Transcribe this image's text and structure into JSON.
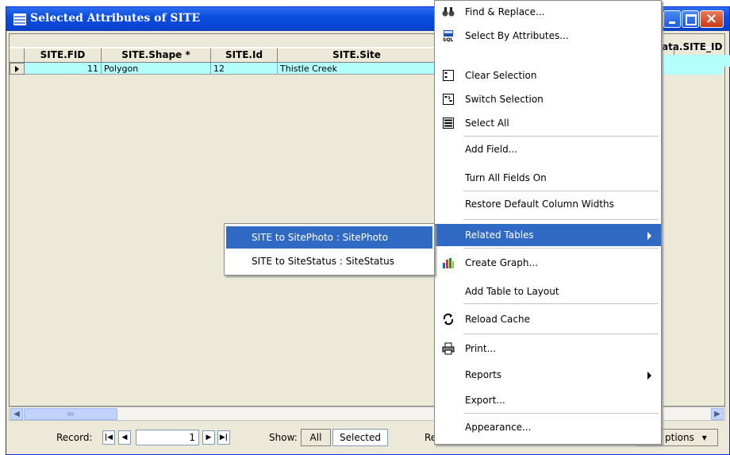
{
  "window": {
    "title": "Selected Attributes of SITE"
  },
  "table": {
    "columns": [
      "SITE.FID",
      "SITE.Shape *",
      "SITE.Id",
      "SITE.Site",
      "ata.SITE_ID"
    ],
    "rows": [
      {
        "fid": "11",
        "shape": "Polygon",
        "id": "12",
        "site": "Thistle Creek"
      }
    ]
  },
  "context_menu": {
    "items": [
      {
        "label": "Find & Replace...",
        "icon": "binoculars-icon"
      },
      {
        "label": "Select By Attributes...",
        "icon": "sql-query-icon"
      },
      {
        "label": "Clear Selection",
        "icon": "clear-selection-icon"
      },
      {
        "label": "Switch Selection",
        "icon": "switch-selection-icon"
      },
      {
        "label": "Select All",
        "icon": "select-all-icon"
      },
      {
        "label": "Add Field..."
      },
      {
        "label": "Turn All Fields On"
      },
      {
        "label": "Restore Default Column Widths"
      },
      {
        "label": "Related Tables",
        "submenu": true,
        "active": true
      },
      {
        "label": "Create Graph...",
        "icon": "graph-icon"
      },
      {
        "label": "Add Table to Layout"
      },
      {
        "label": "Reload Cache",
        "icon": "reload-icon"
      },
      {
        "label": "Print...",
        "icon": "printer-icon"
      },
      {
        "label": "Reports",
        "submenu": true
      },
      {
        "label": "Export..."
      },
      {
        "label": "Appearance..."
      }
    ]
  },
  "related_tables_submenu": {
    "items": [
      {
        "label": "SITE to SitePhoto : SitePhoto",
        "active": true
      },
      {
        "label": "SITE to SiteStatus : SiteStatus"
      }
    ]
  },
  "status_bar": {
    "record_label": "Record:",
    "record_value": "1",
    "show_label": "Show:",
    "show_all": "All",
    "show_selected": "Selected",
    "records_label_partial": "Re",
    "options_label": "ptions"
  },
  "colors": {
    "selection_cyan": "#b3fffe",
    "menu_highlight": "#316ac5",
    "titlebar_blue": "#0a4ee0"
  }
}
